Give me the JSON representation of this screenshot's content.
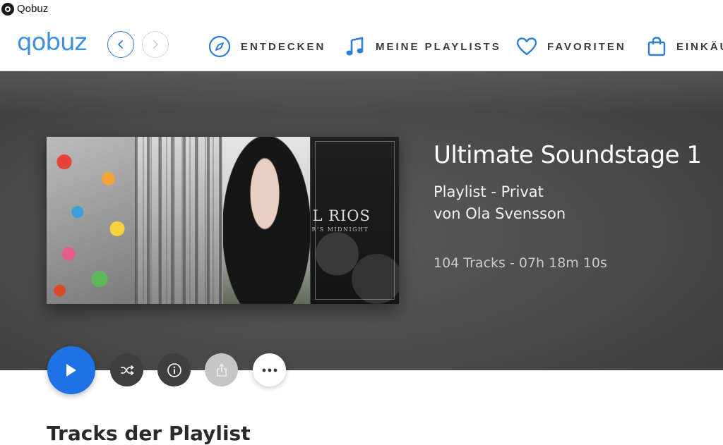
{
  "window": {
    "title": "Qobuz"
  },
  "header": {
    "logo": "qobuz",
    "nav": [
      {
        "label": "ENTDECKEN",
        "icon": "compass-icon"
      },
      {
        "label": "MEINE PLAYLISTS",
        "icon": "music-note-icon"
      },
      {
        "label": "FAVORITEN",
        "icon": "heart-icon"
      },
      {
        "label": "EINKÄU",
        "icon": "shopping-bag-icon"
      }
    ]
  },
  "playlist": {
    "title": "Ultimate Soundstage 1",
    "type": "Playlist - Privat",
    "owner": "von Ola Svensson",
    "stats": "104 Tracks - 07h 18m 10s",
    "cover_text": "EL RIOS",
    "cover_subtext": "DER'S MIDNIGHT"
  },
  "actions": {
    "play": "play-icon",
    "shuffle": "shuffle-icon",
    "info": "info-icon",
    "share": "share-icon",
    "more": "more-icon"
  },
  "section": {
    "title": "Tracks der Playlist"
  },
  "colors": {
    "accent": "#1f72e6",
    "logo": "#3d8fe0",
    "hero_bg": "#4d4d4d"
  }
}
